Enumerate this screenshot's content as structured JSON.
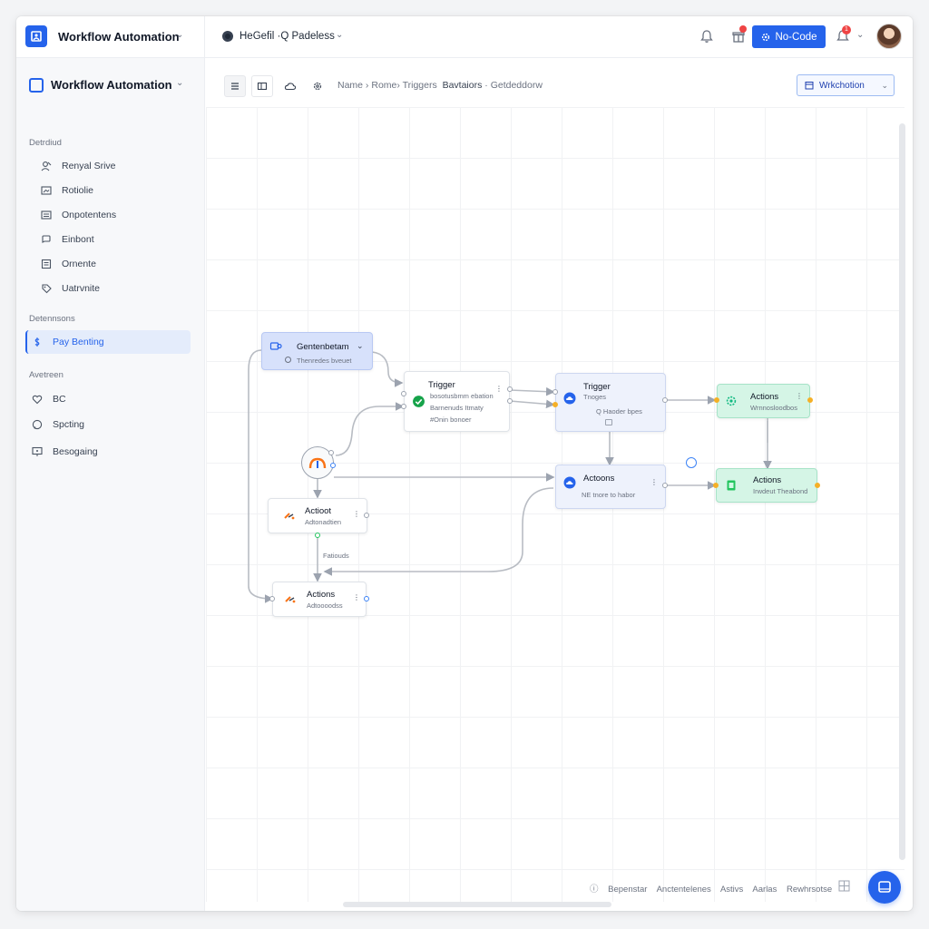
{
  "topbar": {
    "app_title": "Workflow Automation",
    "project_title": "HeGefil ·Q Padeless",
    "nocode_label": "No-Code",
    "alert_count": "1"
  },
  "sidebar": {
    "title": "Workflow Automation",
    "sections": [
      {
        "label": "Detrdiud",
        "items": [
          {
            "label": "Renyal Srive",
            "icon": "users-icon"
          },
          {
            "label": "Rotiolie",
            "icon": "window-icon"
          },
          {
            "label": "Onpotentens",
            "icon": "list-icon"
          },
          {
            "label": "Einbont",
            "icon": "chat-icon"
          },
          {
            "label": "Ornente",
            "icon": "document-icon"
          },
          {
            "label": "Uatrvnite",
            "icon": "tag-icon"
          }
        ]
      },
      {
        "label": "Detennsons",
        "items": [
          {
            "label": "Pay Benting",
            "icon": "dollar-icon",
            "active": true
          }
        ]
      },
      {
        "label": "Avetreen",
        "items": [
          {
            "label": "BC",
            "icon": "heart-icon"
          },
          {
            "label": "Spcting",
            "icon": "chat-icon"
          },
          {
            "label": "Besogaing",
            "icon": "monitor-icon"
          }
        ]
      }
    ]
  },
  "toolbar": {
    "crumbs": [
      "Name",
      "Rome",
      "Triggers",
      "Bavtaiors",
      "Getdeddorw"
    ],
    "workflow_select": "Wrkchotion"
  },
  "nodes": {
    "start": {
      "title": "Gentenbetam",
      "sub": "Thenredes bveuet"
    },
    "trigger_a": {
      "title": "Trigger",
      "sub1": "bosotusbmm ebation",
      "sub2": "Barnenuds Itmaty",
      "sub3": "#Onin bonoer"
    },
    "trigger_b": {
      "title": "Trigger",
      "sub1": "Tnoges",
      "sub2": "Q Haoder bpes"
    },
    "actions_top": {
      "title": "Actions",
      "sub": "Wrnnosloodbos"
    },
    "actions_mid": {
      "title": "Actoons",
      "sub": "NE tnore to habor"
    },
    "actions_mint": {
      "title": "Actions",
      "sub": "Irwdeut Theabond"
    },
    "action_left": {
      "title": "Actioot",
      "sub": "Adtonadtien"
    },
    "actions_bottom": {
      "title": "Actions",
      "sub": "Adtoooodss"
    }
  },
  "edge_label": "Fatiouds",
  "footer": {
    "links": [
      "Bepenstar",
      "Anctentelenes",
      "Astivs",
      "Aarlas",
      "Rewhrsotse"
    ]
  },
  "colors": {
    "accent": "#2563eb",
    "node_blue": "#d7e1fb",
    "node_mint": "#d5f5e6",
    "port_yellow": "#f5b027"
  }
}
